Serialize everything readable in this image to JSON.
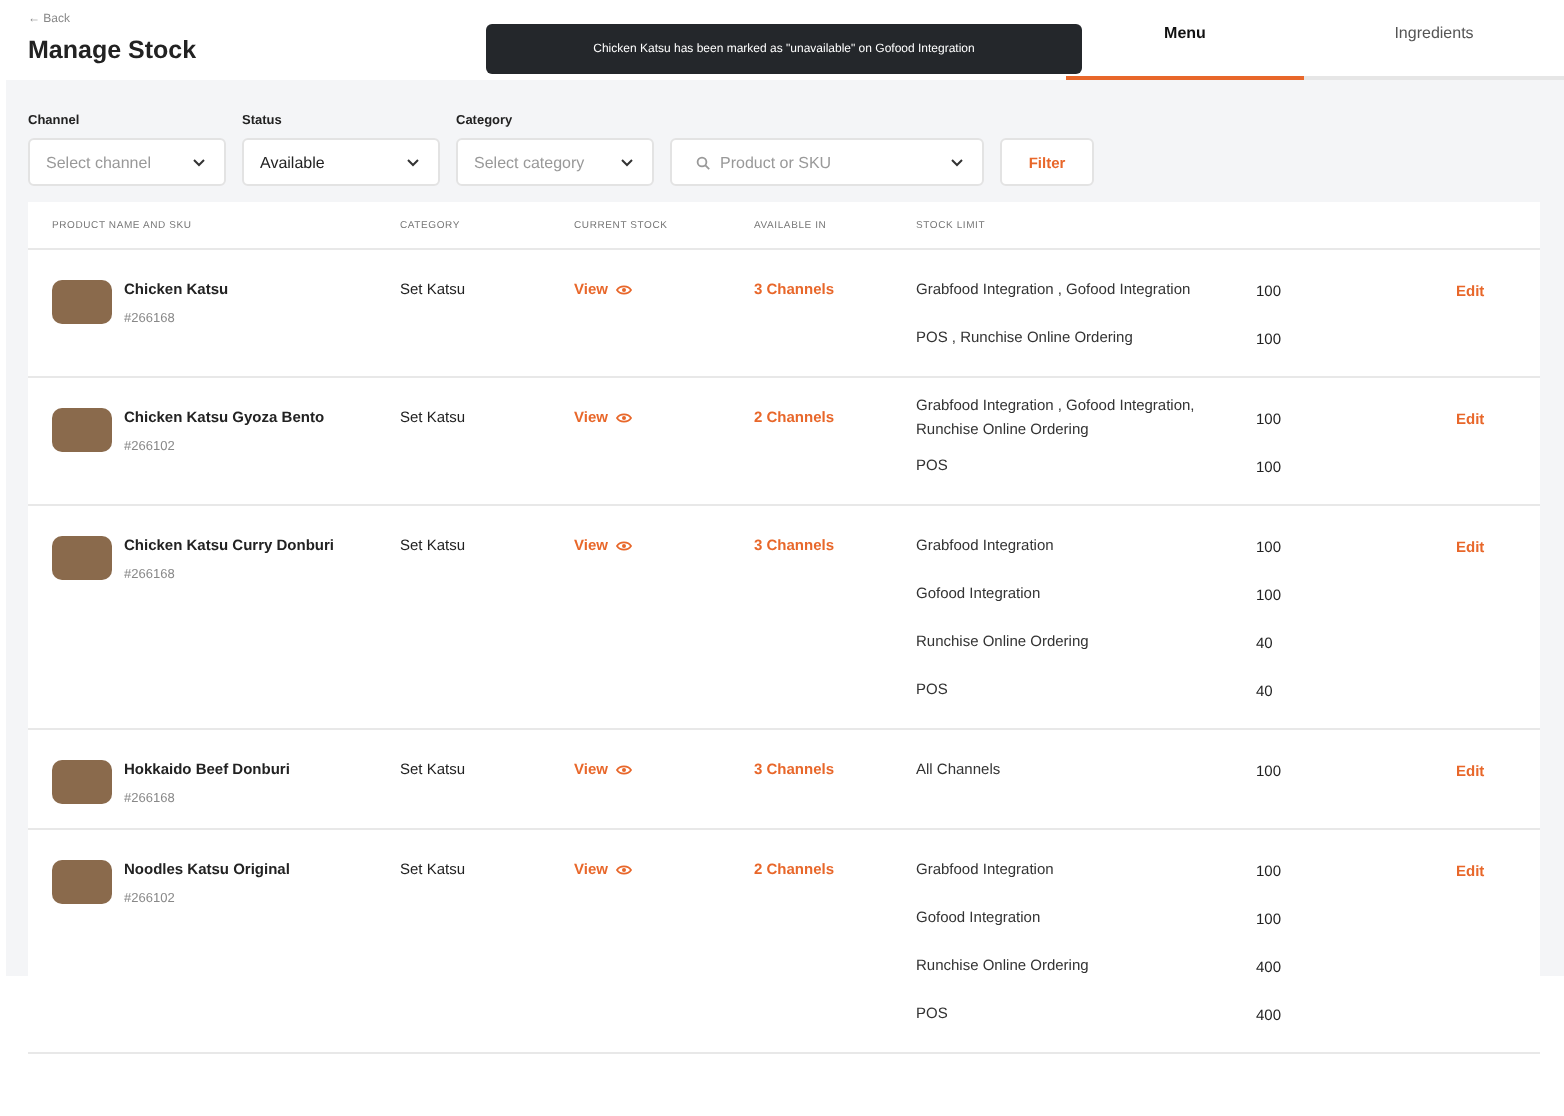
{
  "header": {
    "back": "← Back",
    "title": "Manage Stock"
  },
  "tabs": [
    {
      "label": "Menu",
      "selected": true
    },
    {
      "label": "Ingredients",
      "selected": false
    }
  ],
  "toast": {
    "message": "Chicken Katsu has been marked as \"unavailable\" on Gofood Integration"
  },
  "filters": [
    {
      "kind": "select",
      "label": "Channel",
      "placeholder": "Select channel"
    },
    {
      "kind": "select",
      "label": "Status",
      "value": "Available"
    },
    {
      "kind": "select",
      "label": "Category",
      "placeholder": "Select category"
    },
    {
      "kind": "search",
      "placeholder": "Product or SKU"
    }
  ],
  "filter_button": "Filter",
  "table": {
    "columns": [
      "PRODUCT NAME AND SKU",
      "CATEGORY",
      "CURRENT STOCK",
      "AVAILABLE IN",
      "STOCK LIMIT"
    ],
    "rows": [
      {
        "name": "Chicken Katsu",
        "sku": "#266168",
        "category": "Set Katsu",
        "stock": "View",
        "available": "3 Channels",
        "edit": "Edit",
        "limits": [
          {
            "channels": "Grabfood Integration , Gofood Integration",
            "qty": "100"
          },
          {
            "channels": "POS , Runchise Online Ordering",
            "qty": "100"
          }
        ]
      },
      {
        "name": "Chicken Katsu Gyoza Bento",
        "sku": "#266102",
        "category": "Set Katsu",
        "stock": "View",
        "available": "2 Channels",
        "edit": "Edit",
        "limits": [
          {
            "channels": "Grabfood Integration , Gofood Integration, Runchise Online Ordering",
            "qty": "100"
          },
          {
            "channels": "POS",
            "qty": "100"
          }
        ]
      },
      {
        "name": "Chicken Katsu Curry Donburi",
        "sku": "#266168",
        "category": "Set Katsu",
        "stock": "View",
        "available": "3 Channels",
        "edit": "Edit",
        "limits": [
          {
            "channels": "Grabfood Integration",
            "qty": "100"
          },
          {
            "channels": "Gofood Integration",
            "qty": "100"
          },
          {
            "channels": "Runchise Online Ordering",
            "qty": "40"
          },
          {
            "channels": "POS",
            "qty": "40"
          }
        ]
      },
      {
        "name": "Hokkaido Beef Donburi",
        "sku": "#266168",
        "category": "Set Katsu",
        "stock": "View",
        "available": "3 Channels",
        "edit": "Edit",
        "limits": [
          {
            "channels": "All Channels",
            "qty": "100"
          }
        ]
      },
      {
        "name": "Noodles Katsu Original",
        "sku": "#266102",
        "category": "Set Katsu",
        "stock": "View",
        "available": "2 Channels",
        "edit": "Edit",
        "limits": [
          {
            "channels": "Grabfood Integration",
            "qty": "100"
          },
          {
            "channels": "Gofood Integration",
            "qty": "100"
          },
          {
            "channels": "Runchise Online Ordering",
            "qty": "400"
          },
          {
            "channels": "POS",
            "qty": "400"
          }
        ]
      }
    ]
  }
}
